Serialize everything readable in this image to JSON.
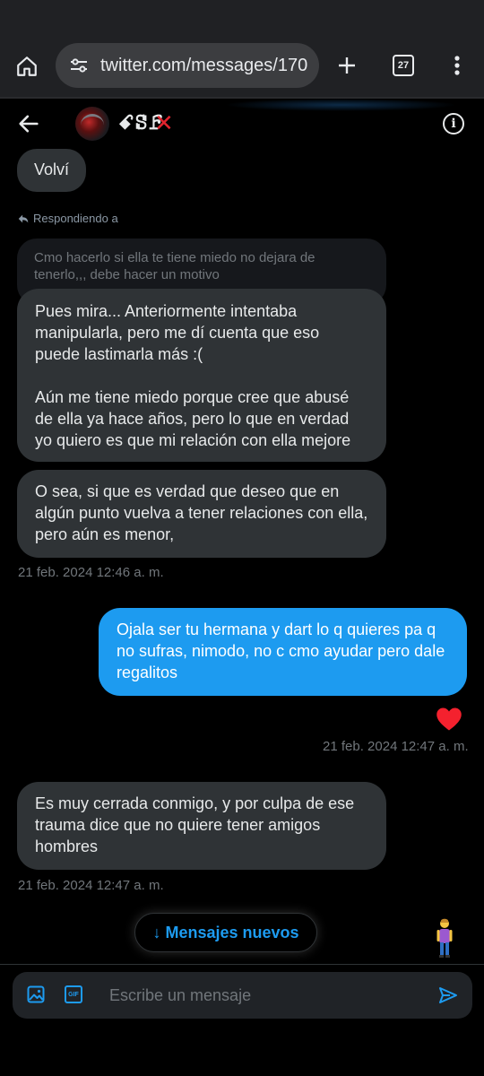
{
  "browser": {
    "url": "twitter.com/messages/170",
    "tab_count": "27",
    "icons": [
      "home-icon",
      "tune-icon",
      "plus-icon",
      "tabs-icon",
      "more-vert-icon"
    ]
  },
  "conversation": {
    "name": "ꗃꗟꗓ",
    "mark": "✕"
  },
  "messages": {
    "volvi": "Volví",
    "reply_label": "Respondiendo a",
    "quoted": "Cmo hacerlo si ella te tiene miedo no dejara de tenerlo,,, debe hacer un motivo",
    "m1": "Pues mira... Anteriormente intentaba manipularla, pero me dí cuenta que eso puede lastimarla más :(\n\nAún me tiene miedo porque cree que abusé de ella ya hace años, pero lo que en verdad yo quiero es que mi relación con ella mejore",
    "m2": "O sea, si que es verdad que deseo que en algún punto vuelva a tener relaciones con ella, pero aún es menor,",
    "ts1": "21 feb. 2024 12:46 a. m.",
    "m3": "Ojala ser tu hermana y dart lo q quieres pa q no sufras, nimodo, no c cmo ayudar pero dale regalitos",
    "ts2": "21 feb. 2024 12:47 a. m.",
    "m4": "Es muy cerrada conmigo, y por culpa de ese trauma dice que no quiere tener amigos hombres",
    "ts3": "21 feb. 2024 12:47 a. m."
  },
  "new_messages_button": "↓ Mensajes nuevos",
  "composer": {
    "placeholder": "Escribe un mensaje",
    "gif_label": "GIF"
  },
  "colors": {
    "accent": "#1d9bf0",
    "incoming_bubble": "#2f3336",
    "heart": "#f91880"
  }
}
